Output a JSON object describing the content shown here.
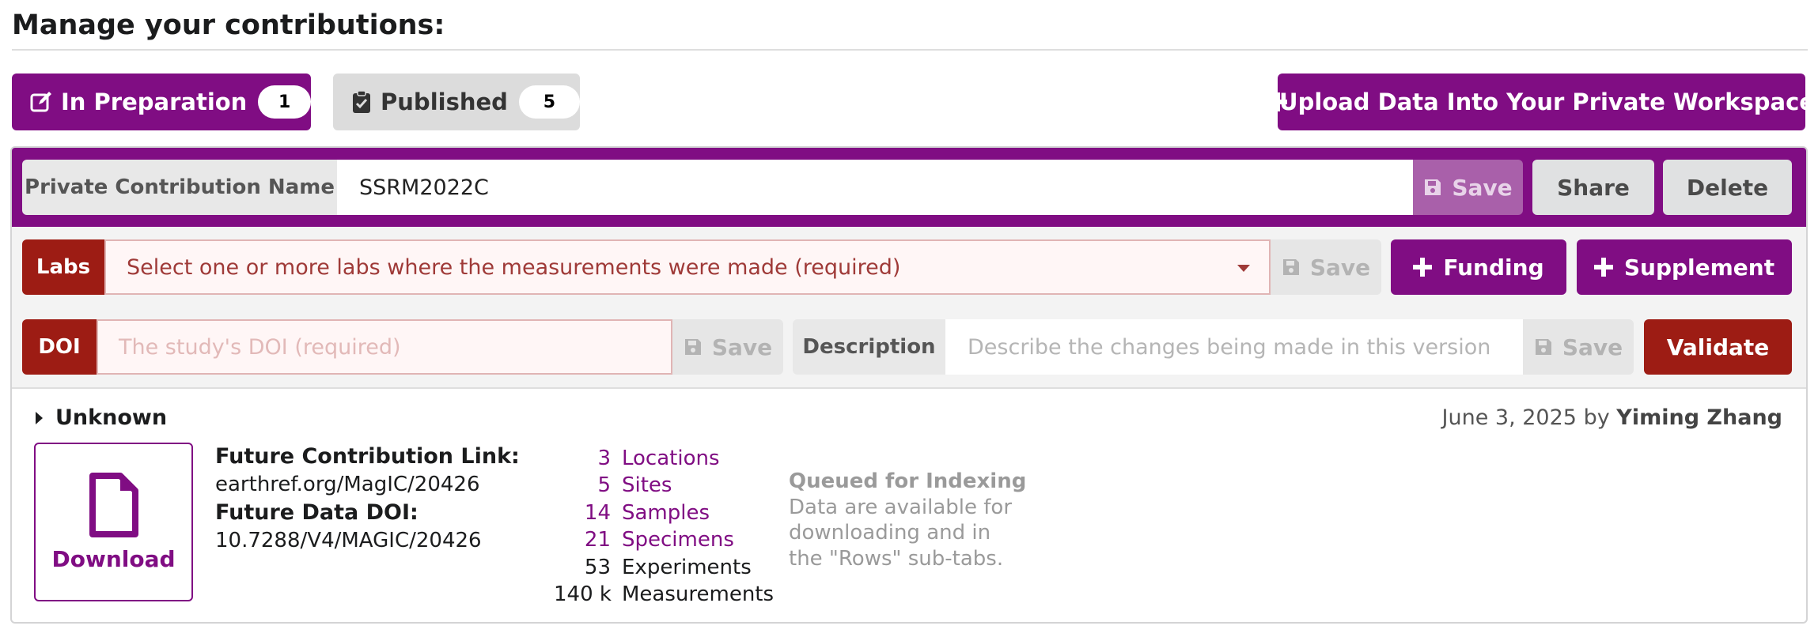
{
  "page": {
    "title": "Manage your contributions:"
  },
  "tabs": [
    {
      "label": "In Preparation",
      "count": "1",
      "icon": "edit-icon"
    },
    {
      "label": "Published",
      "count": "5",
      "icon": "clipboard-check-icon"
    }
  ],
  "upload_button": {
    "label": "Upload Data Into Your Private Workspace",
    "icon": "plus-icon"
  },
  "colors": {
    "accent": "#800d83",
    "error": "#9d1c14",
    "neutral": "#e0e1e2"
  },
  "form": {
    "name_label": "Private Contribution Name",
    "name_value": "SSRM2022C",
    "save_label": "Save",
    "share_label": "Share",
    "delete_label": "Delete",
    "labs_label": "Labs",
    "labs_placeholder": "Select one or more labs where the measurements were made (required)",
    "funding_label": "Funding",
    "supplement_label": "Supplement",
    "doi_label": "DOI",
    "doi_placeholder": "The study's DOI (required)",
    "description_label": "Description",
    "description_placeholder": "Describe the changes being made in this version",
    "validate_label": "Validate"
  },
  "contribution": {
    "section_label": "Unknown",
    "date": "June 3, 2025",
    "by_word": "by",
    "author": "Yiming Zhang",
    "download_label": "Download",
    "future_link_label": "Future Contribution Link:",
    "future_link": "earthref.org/MagIC/20426",
    "future_doi_label": "Future Data DOI:",
    "future_doi": "10.7288/V4/MAGIC/20426",
    "counts": [
      {
        "num": "3",
        "label": "Locations",
        "link": true
      },
      {
        "num": "5",
        "label": "Sites",
        "link": true
      },
      {
        "num": "14",
        "label": "Samples",
        "link": true
      },
      {
        "num": "21",
        "label": "Specimens",
        "link": true
      },
      {
        "num": "53",
        "label": "Experiments",
        "link": false
      },
      {
        "num": "140 k",
        "label": "Measurements",
        "link": false
      }
    ],
    "status_title": "Queued for Indexing",
    "status_lines": [
      "Data are available for",
      "downloading and in",
      "the \"Rows\" sub-tabs."
    ]
  }
}
